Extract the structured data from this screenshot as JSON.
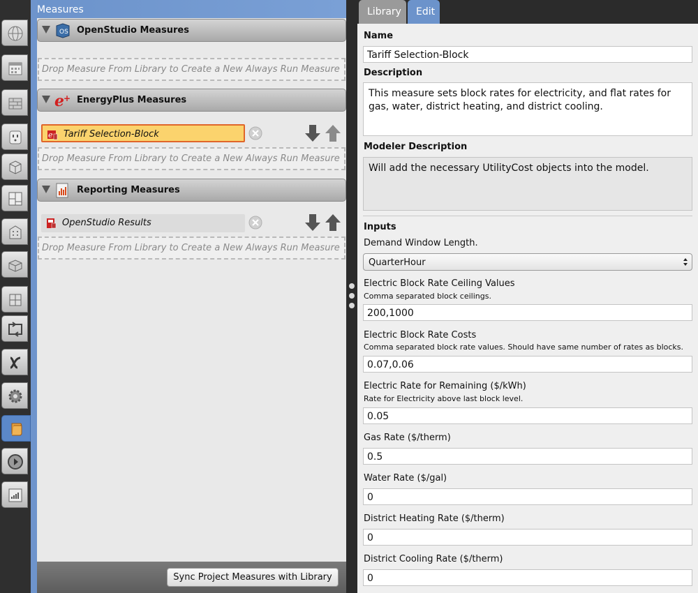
{
  "left_panel": {
    "title": "Measures",
    "sections": [
      {
        "title": "OpenStudio Measures",
        "icon": "openstudio-os-icon"
      },
      {
        "title": "EnergyPlus Measures",
        "icon": "energyplus-e-icon"
      },
      {
        "title": "Reporting Measures",
        "icon": "reporting-chart-icon"
      }
    ],
    "drop_zone_text": "Drop Measure From Library to Create a New Always Run Measure",
    "measures": {
      "energyplus": "Tariff Selection-Block",
      "reporting": "OpenStudio Results"
    },
    "sync_button": "Sync Project Measures with Library"
  },
  "vertical_tabs": [
    "site-globe-icon",
    "schedules-calendar-icon",
    "constructions-bricks-icon",
    "loads-outlet-icon",
    "geometry-cube-icon",
    "spaces-floorplan-icon",
    "thermal-zones-building-icon",
    "building-stories-icon",
    "facility-icon",
    "hvac-loop-icon",
    "variables-icon",
    "simulation-settings-gear-icon",
    "measures-scroll-icon",
    "run-play-icon",
    "results-chart-icon"
  ],
  "right_panel": {
    "tabs": [
      "Library",
      "Edit"
    ],
    "name_label": "Name",
    "name_value": "Tariff Selection-Block",
    "description_label": "Description",
    "description_value": "This measure sets block rates for electricity, and flat rates for gas, water, district heating, and district cooling.",
    "modeler_description_label": "Modeler Description",
    "modeler_description_value": "Will add the necessary UtilityCost objects into the model.",
    "inputs_label": "Inputs",
    "inputs": {
      "demand_window": {
        "label": "Demand Window Length.",
        "value": "QuarterHour"
      },
      "block_ceilings": {
        "label": "Electric Block Rate Ceiling Values",
        "hint": "Comma separated block ceilings.",
        "value": "200,1000"
      },
      "block_costs": {
        "label": "Electric Block Rate Costs",
        "hint": "Comma separated block rate values. Should have same number of rates as blocks.",
        "value": "0.07,0.06"
      },
      "remaining_rate": {
        "label": "Electric Rate for Remaining ($/kWh)",
        "hint": "Rate for Electricity above last block level.",
        "value": "0.05"
      },
      "gas_rate": {
        "label": "Gas Rate ($/therm)",
        "value": "0.5"
      },
      "water_rate": {
        "label": "Water Rate ($/gal)",
        "value": "0"
      },
      "district_heating": {
        "label": "District Heating Rate ($/therm)",
        "value": "0"
      },
      "district_cooling": {
        "label": "District Cooling Rate ($/therm)",
        "value": "0"
      }
    }
  },
  "colors": {
    "accent_blue": "#6c93cb",
    "selected_fill": "#fbd36d",
    "selected_border": "#e0662a"
  }
}
